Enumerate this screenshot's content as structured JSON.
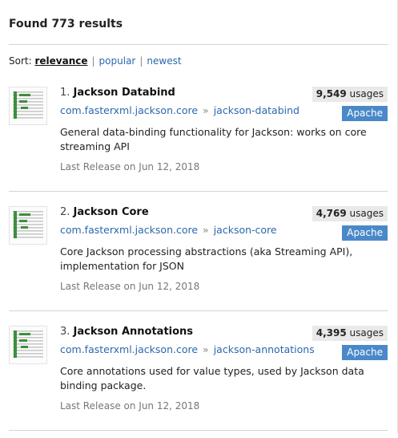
{
  "header": {
    "found_text": "Found 773 results"
  },
  "sort": {
    "label": "Sort:",
    "options": [
      {
        "label": "relevance",
        "active": true
      },
      {
        "label": "popular",
        "active": false
      },
      {
        "label": "newest",
        "active": false
      }
    ]
  },
  "results": [
    {
      "index": "1.",
      "name": "Jackson Databind",
      "group": "com.fasterxml.jackson.core",
      "separator": "»",
      "artifact": "jackson-databind",
      "usages_count": "9,549",
      "usages_label": "usages",
      "license": "Apache",
      "description": "General data-binding functionality for Jackson: works on core streaming API",
      "release": "Last Release on Jun 12, 2018",
      "logo_icon": "fasterxml-jackson-logo-icon"
    },
    {
      "index": "2.",
      "name": "Jackson Core",
      "group": "com.fasterxml.jackson.core",
      "separator": "»",
      "artifact": "jackson-core",
      "usages_count": "4,769",
      "usages_label": "usages",
      "license": "Apache",
      "description": "Core Jackson processing abstractions (aka Streaming API), implementation for JSON",
      "release": "Last Release on Jun 12, 2018",
      "logo_icon": "fasterxml-jackson-logo-icon"
    },
    {
      "index": "3.",
      "name": "Jackson Annotations",
      "group": "com.fasterxml.jackson.core",
      "separator": "»",
      "artifact": "jackson-annotations",
      "usages_count": "4,395",
      "usages_label": "usages",
      "license": "Apache",
      "description": "Core annotations used for value types, used by Jackson data binding package.",
      "release": "Last Release on Jun 12, 2018",
      "logo_icon": "fasterxml-jackson-logo-icon"
    }
  ],
  "colors": {
    "link": "#2b68ad",
    "license_badge": "#4a89c9",
    "usage_badge": "#e9e9e9",
    "logo_green": "#3e8e3e"
  }
}
